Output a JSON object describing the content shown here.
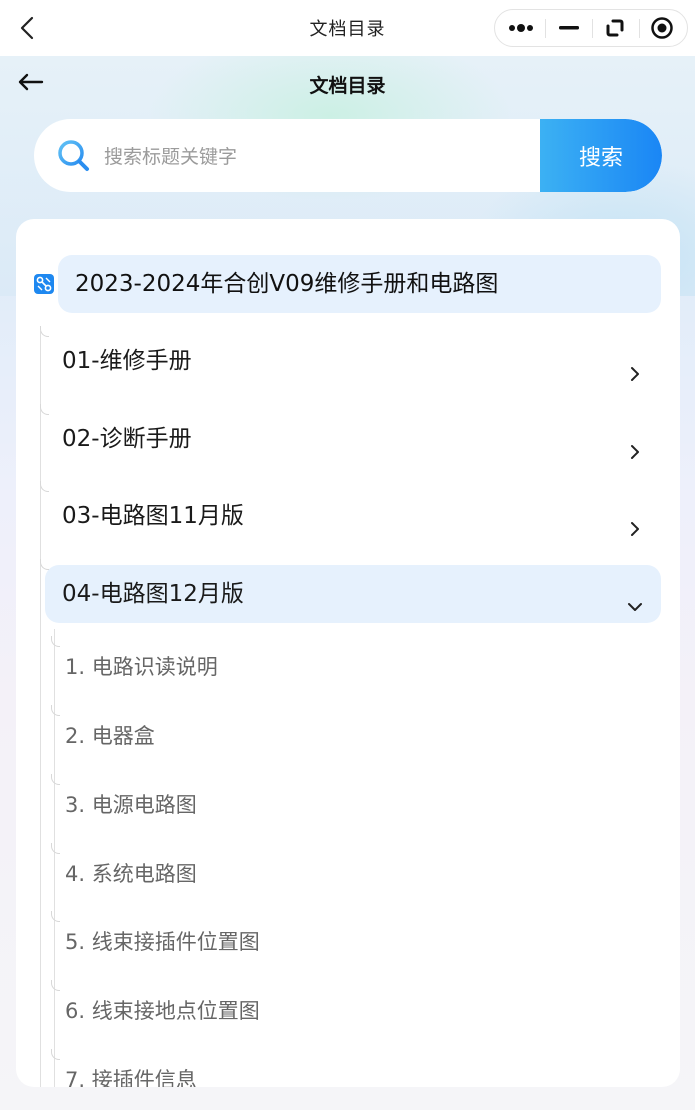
{
  "wechat_bar": {
    "title": "文档目录"
  },
  "header": {
    "title": "文档目录"
  },
  "search": {
    "placeholder": "搜索标题关键字",
    "value": "",
    "button_label": "搜索"
  },
  "tree": {
    "root_label": "2023-2024年合创V09维修手册和电路图",
    "sections": [
      {
        "label": "01-维修手册",
        "expanded": false
      },
      {
        "label": "02-诊断手册",
        "expanded": false
      },
      {
        "label": "03-电路图11月版",
        "expanded": false
      },
      {
        "label": "04-电路图12月版",
        "expanded": true
      }
    ],
    "children": [
      "1. 电路识读说明",
      "2. 电器盒",
      "3. 电源电路图",
      "4. 系统电路图",
      "5. 线束接插件位置图",
      "6. 线束接地点位置图",
      "7. 接插件信息"
    ]
  },
  "colors": {
    "accent_blue": "#1a86f5",
    "highlight_bg": "#e6f1fd"
  }
}
